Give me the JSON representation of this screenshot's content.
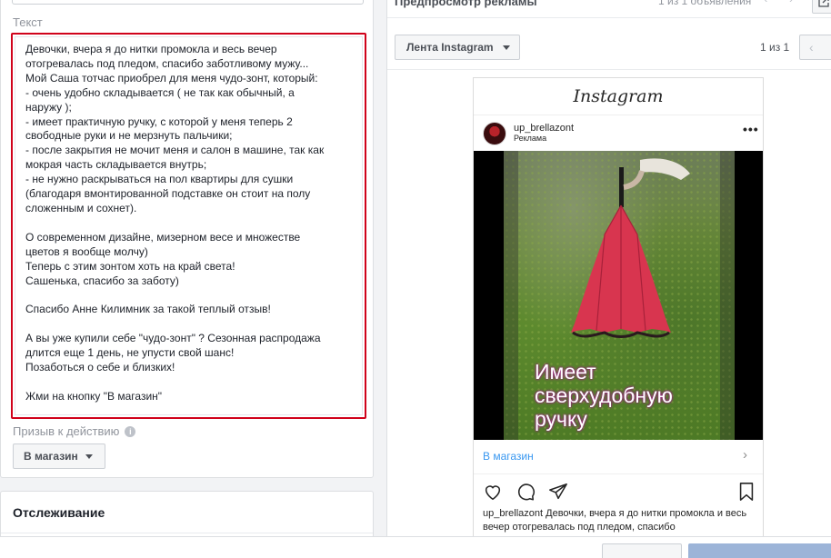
{
  "left": {
    "text_label": "Текст",
    "ad_text": "Девочки, вчера я до нитки промокла и весь вечер\nотогревалась под пледом, спасибо заботливому мужу...\nМой Саша тотчас приобрел для меня чудо-зонт, который:\n- очень удобно складывается ( не так как обычный, а\nнаружу );\n- имеет практичную ручку, с которой у меня теперь 2\nсвободные руки и не мерзнуть пальчики;\n- после закрытия не мочит меня и салон в машине, так как\nмокрая часть складывается внутрь;\n- не нужно раскрываться на пол квартиры для сушки\n(благодаря вмонтированной подставке он стоит на полу\nсложенным и сохнет).\n\nО современном дизайне, мизерном весе и множестве\nцветов я вообще молчу)\nТеперь с этим зонтом хоть на край света!\nСашенька, спасибо за заботу)\n\nСпасибо Анне Килимник за такой теплый отзыв!\n\nА вы уже купили себе \"чудо-зонт\" ? Сезонная распродажа\nдлится еще 1 день, не упусти свой шанс!\nПозаботься о себе и близких!\n\nЖми на кнопку \"В магазин\"",
    "cta_label": "Призыв к действию",
    "cta_value": "В магазин",
    "tracking_title": "Отслеживание"
  },
  "right": {
    "preview_title": "Предпросмотр рекламы",
    "ad_counter": "1 из 1 объявления",
    "placement": "Лента Instagram",
    "pager": "1 из 1"
  },
  "instagram": {
    "logo": "Instagram",
    "username": "up_brellazont",
    "sponsored": "Реклама",
    "video_overlay": "Имеет сверхудобную ручку",
    "cta": "В магазин",
    "caption_user": "up_brellazont",
    "caption_text": "Девочки, вчера я до нитки промокла и весь вечер отогревалась под пледом, спасибо"
  },
  "colors": {
    "highlight_border": "#d0021b",
    "link_blue": "#3897f0",
    "umbrella": "#d8354f"
  }
}
